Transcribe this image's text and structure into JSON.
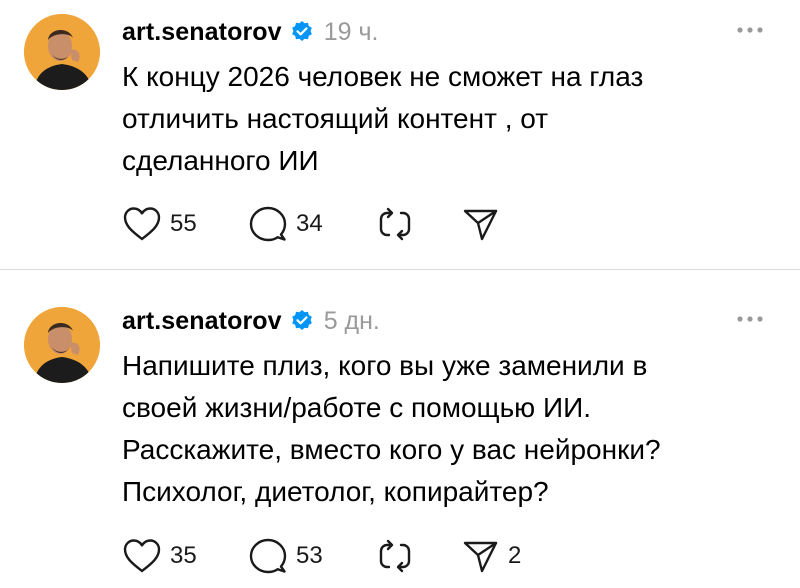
{
  "posts": [
    {
      "username": "art.senatorov",
      "time": "19 ч.",
      "text_lines": [
        "К концу 2026 человек не сможет на глаз",
        "отличить настоящий контент , от",
        "сделанного ИИ"
      ],
      "likes": "55",
      "comments": "34",
      "reposts": "",
      "shares": ""
    },
    {
      "username": "art.senatorov",
      "time": "5 дн.",
      "text_lines": [
        "Напишите плиз, кого вы уже заменили в",
        "своей жизни/работе с помощью ИИ.",
        "Расскажите, вместо кого у вас нейронки?",
        "Психолог, диетолог, копирайтер?"
      ],
      "likes": "35",
      "comments": "53",
      "reposts": "",
      "shares": "2"
    }
  ],
  "icons": {
    "verified": "verified-badge-icon",
    "more": "more-options-icon",
    "like": "heart-icon",
    "comment": "speech-bubble-icon",
    "repost": "repost-icon",
    "share": "paper-plane-icon"
  },
  "colors": {
    "verified_badge": "#0095f6",
    "timestamp": "#9a9a9a",
    "avatar_background": "#f0a53a",
    "divider": "#dbdbdb"
  }
}
